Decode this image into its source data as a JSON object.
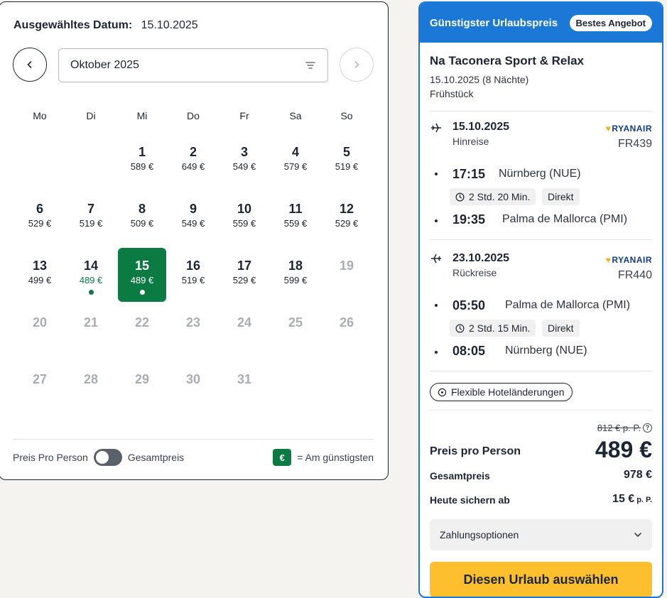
{
  "calendar": {
    "selected_label": "Ausgewähltes Datum:",
    "selected_value": "15.10.2025",
    "month": "Oktober 2025",
    "weekdays": [
      "Mo",
      "Di",
      "Mi",
      "Do",
      "Fr",
      "Sa",
      "So"
    ],
    "days": [
      {
        "num": "1",
        "price": "589 €"
      },
      {
        "num": "2",
        "price": "649 €"
      },
      {
        "num": "3",
        "price": "549 €"
      },
      {
        "num": "4",
        "price": "579 €"
      },
      {
        "num": "5",
        "price": "519 €"
      },
      {
        "num": "6",
        "price": "529 €"
      },
      {
        "num": "7",
        "price": "519 €"
      },
      {
        "num": "8",
        "price": "509 €"
      },
      {
        "num": "9",
        "price": "549 €"
      },
      {
        "num": "10",
        "price": "559 €"
      },
      {
        "num": "11",
        "price": "559 €"
      },
      {
        "num": "12",
        "price": "529 €"
      },
      {
        "num": "13",
        "price": "499 €"
      },
      {
        "num": "14",
        "price": "489 €",
        "cheapest": true
      },
      {
        "num": "15",
        "price": "489 €",
        "cheapest": true,
        "selected": true
      },
      {
        "num": "16",
        "price": "519 €"
      },
      {
        "num": "17",
        "price": "529 €"
      },
      {
        "num": "18",
        "price": "599 €"
      },
      {
        "num": "19",
        "price": "",
        "disabled": true
      },
      {
        "num": "20",
        "price": "",
        "disabled": true
      },
      {
        "num": "21",
        "price": "",
        "disabled": true
      },
      {
        "num": "22",
        "price": "",
        "disabled": true
      },
      {
        "num": "23",
        "price": "",
        "disabled": true
      },
      {
        "num": "24",
        "price": "",
        "disabled": true
      },
      {
        "num": "25",
        "price": "",
        "disabled": true
      },
      {
        "num": "26",
        "price": "",
        "disabled": true
      },
      {
        "num": "27",
        "price": "",
        "disabled": true
      },
      {
        "num": "28",
        "price": "",
        "disabled": true
      },
      {
        "num": "29",
        "price": "",
        "disabled": true
      },
      {
        "num": "30",
        "price": "",
        "disabled": true
      },
      {
        "num": "31",
        "price": "",
        "disabled": true
      }
    ],
    "footer": {
      "per_person": "Preis Pro Person",
      "total": "Gesamtpreis",
      "legend_badge": "€",
      "legend_text": "= Am günstigsten"
    },
    "colors": {
      "cheapest": "#0b7a43"
    }
  },
  "offer": {
    "header_title": "Günstigster Urlaubspreis",
    "badge": "Bestes Angebot",
    "hotel": "Na Taconera Sport & Relax",
    "dates": "15.10.2025 (8 Nächte)",
    "board": "Frühstück",
    "outbound": {
      "date": "15.10.2025",
      "type": "Hinreise",
      "airline": "RYANAIR",
      "flight": "FR439",
      "dep_time": "17:15",
      "dep_place": "Nürnberg (NUE)",
      "duration": "2 Std. 20 Min.",
      "stops": "Direkt",
      "arr_time": "19:35",
      "arr_place": "Palma de Mallorca (PMI)"
    },
    "inbound": {
      "date": "23.10.2025",
      "type": "Rückreise",
      "airline": "RYANAIR",
      "flight": "FR440",
      "dep_time": "05:50",
      "dep_place": "Palma de Mallorca (PMI)",
      "duration": "2 Std. 15 Min.",
      "stops": "Direkt",
      "arr_time": "08:05",
      "arr_place": "Nürnberg (NUE)"
    },
    "flex_label": "Flexible Hoteländerungen",
    "old_price": "812 € p. P.",
    "pp_label": "Preis pro Person",
    "pp_price": "489 €",
    "total_label": "Gesamtpreis",
    "total_value": "978 €",
    "deposit_label": "Heute sichern ab",
    "deposit_value": "15 €",
    "deposit_unit": "p. P.",
    "payment_label": "Zahlungsoptionen",
    "cta": "Diesen Urlaub auswählen",
    "colors": {
      "header": "#1b78d6",
      "cta": "#fdbf2d"
    }
  }
}
